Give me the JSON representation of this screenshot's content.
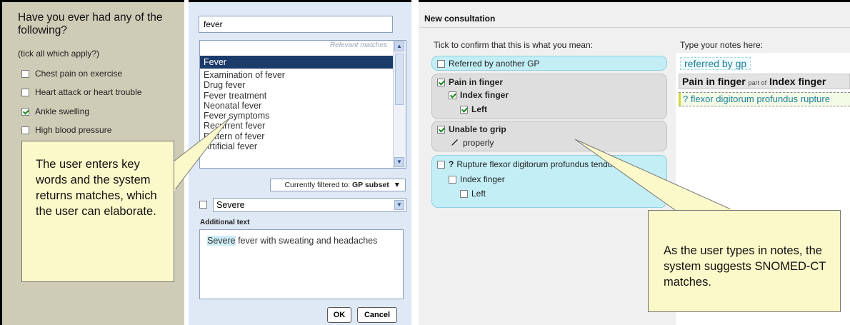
{
  "questionnaire": {
    "title": "Have you ever had any of the following?",
    "subtitle": "(tick all which apply?)",
    "items": [
      {
        "label": "Chest pain on exercise",
        "checked": false
      },
      {
        "label": "Heart attack or heart trouble",
        "checked": false
      },
      {
        "label": "Ankle swelling",
        "checked": true
      },
      {
        "label": "High blood pressure",
        "checked": false
      }
    ]
  },
  "search": {
    "query": "fever",
    "matches_header": "Relevant matches",
    "matches": [
      "Fever",
      "Examination of fever",
      "Drug fever",
      "Fever treatment",
      "Neonatal fever",
      "Fever symptoms",
      "Recurrent fever",
      "Pattern of fever",
      "Artificial fever"
    ],
    "filter_label": "Currently filtered to:",
    "filter_value": "GP subset",
    "qualifier": "Severe",
    "additional_label": "Additional text",
    "additional_highlight": "Severe",
    "additional_rest": " fever with sweating and headaches",
    "ok_label": "OK",
    "cancel_label": "Cancel"
  },
  "consultation": {
    "title": "New consultation",
    "tick_label": "Tick to confirm that this is what you mean:",
    "notes_label": "Type your notes here:",
    "suggestions": {
      "referred": "Referred by another GP",
      "pain_finger": "Pain in finger",
      "index_finger": "Index finger",
      "left": "Left",
      "unable_grip": "Unable to grip",
      "properly": "properly",
      "rupture_prefix": "?",
      "rupture": "Rupture flexor digitorum profundus tendon",
      "index_finger_2": "Index finger",
      "left_2": "Left"
    },
    "notes": {
      "line1": "referred by gp",
      "line2_main": "Pain in finger",
      "line2_part": "part of",
      "line2_tail": "Index finger",
      "line3": "? flexor digitorum profundus rupture"
    }
  },
  "callouts": {
    "left": "The user enters key words and the system returns matches, which the user can elaborate.",
    "right": "As the user types in notes, the system suggests SNOMED-CT matches."
  },
  "colors": {
    "left_panel": "#ceccb6",
    "mid_panel": "#dfe8f5",
    "selected": "#1b3c6b",
    "pill_cyan": "#c3eef6",
    "pill_gray": "#dedede",
    "callout": "#fbf8c9"
  }
}
